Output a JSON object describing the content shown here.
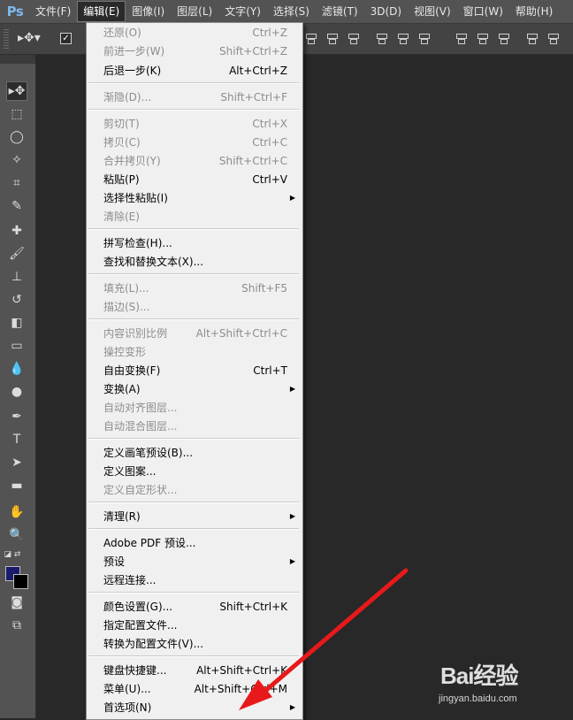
{
  "app": {
    "logo": "Ps"
  },
  "menubar": {
    "items": [
      {
        "label": "文件(F)"
      },
      {
        "label": "编辑(E)"
      },
      {
        "label": "图像(I)"
      },
      {
        "label": "图层(L)"
      },
      {
        "label": "文字(Y)"
      },
      {
        "label": "选择(S)"
      },
      {
        "label": "滤镜(T)"
      },
      {
        "label": "3D(D)"
      },
      {
        "label": "视图(V)"
      },
      {
        "label": "窗口(W)"
      },
      {
        "label": "帮助(H)"
      }
    ],
    "active": "编辑(E)"
  },
  "edit_menu": {
    "items": [
      {
        "label": "还原(O)",
        "shortcut": "Ctrl+Z",
        "enabled": false
      },
      {
        "label": "前进一步(W)",
        "shortcut": "Shift+Ctrl+Z",
        "enabled": false
      },
      {
        "label": "后退一步(K)",
        "shortcut": "Alt+Ctrl+Z",
        "enabled": true
      },
      {
        "label": "渐隐(D)...",
        "shortcut": "Shift+Ctrl+F",
        "enabled": false
      },
      {
        "label": "剪切(T)",
        "shortcut": "Ctrl+X",
        "enabled": false
      },
      {
        "label": "拷贝(C)",
        "shortcut": "Ctrl+C",
        "enabled": false
      },
      {
        "label": "合并拷贝(Y)",
        "shortcut": "Shift+Ctrl+C",
        "enabled": false
      },
      {
        "label": "粘贴(P)",
        "shortcut": "Ctrl+V",
        "enabled": true
      },
      {
        "label": "选择性粘贴(I)",
        "shortcut": "",
        "enabled": true,
        "submenu": true
      },
      {
        "label": "清除(E)",
        "shortcut": "",
        "enabled": false
      },
      {
        "label": "拼写检查(H)...",
        "shortcut": "",
        "enabled": true
      },
      {
        "label": "查找和替换文本(X)...",
        "shortcut": "",
        "enabled": true
      },
      {
        "label": "填充(L)...",
        "shortcut": "Shift+F5",
        "enabled": false
      },
      {
        "label": "描边(S)...",
        "shortcut": "",
        "enabled": false
      },
      {
        "label": "内容识别比例",
        "shortcut": "Alt+Shift+Ctrl+C",
        "enabled": false
      },
      {
        "label": "操控变形",
        "shortcut": "",
        "enabled": false
      },
      {
        "label": "自由变换(F)",
        "shortcut": "Ctrl+T",
        "enabled": true
      },
      {
        "label": "变换(A)",
        "shortcut": "",
        "enabled": true,
        "submenu": true
      },
      {
        "label": "自动对齐图层...",
        "shortcut": "",
        "enabled": false
      },
      {
        "label": "自动混合图层...",
        "shortcut": "",
        "enabled": false
      },
      {
        "label": "定义画笔预设(B)...",
        "shortcut": "",
        "enabled": true
      },
      {
        "label": "定义图案...",
        "shortcut": "",
        "enabled": true
      },
      {
        "label": "定义自定形状...",
        "shortcut": "",
        "enabled": false
      },
      {
        "label": "清理(R)",
        "shortcut": "",
        "enabled": true,
        "submenu": true
      },
      {
        "label": "Adobe PDF 预设...",
        "shortcut": "",
        "enabled": true
      },
      {
        "label": "预设",
        "shortcut": "",
        "enabled": true,
        "submenu": true
      },
      {
        "label": "远程连接...",
        "shortcut": "",
        "enabled": true
      },
      {
        "label": "颜色设置(G)...",
        "shortcut": "Shift+Ctrl+K",
        "enabled": true
      },
      {
        "label": "指定配置文件...",
        "shortcut": "",
        "enabled": true
      },
      {
        "label": "转换为配置文件(V)...",
        "shortcut": "",
        "enabled": true
      },
      {
        "label": "键盘快捷键...",
        "shortcut": "Alt+Shift+Ctrl+K",
        "enabled": true
      },
      {
        "label": "菜单(U)...",
        "shortcut": "Alt+Shift+Ctrl+M",
        "enabled": true
      },
      {
        "label": "首选项(N)",
        "shortcut": "",
        "enabled": true,
        "submenu": true
      }
    ]
  },
  "toolbar": {
    "tools": [
      "move-tool-icon",
      "marquee-tool-icon",
      "lasso-tool-icon",
      "magic-wand-icon",
      "crop-tool-icon",
      "eyedropper-icon",
      "healing-brush-icon",
      "brush-tool-icon",
      "clone-stamp-icon",
      "history-brush-icon",
      "eraser-icon",
      "gradient-icon",
      "blur-tool-icon",
      "dodge-tool-icon",
      "pen-tool-icon",
      "type-tool-icon",
      "path-selection-icon",
      "shape-tool-icon",
      "hand-tool-icon",
      "zoom-tool-icon"
    ],
    "foreground_color": "#1a1a6e",
    "background_color": "#000000"
  },
  "watermark": {
    "title": "Bai经验",
    "url": "jingyan.baidu.com"
  },
  "annotation": {
    "arrow_color": "#e8191b"
  }
}
